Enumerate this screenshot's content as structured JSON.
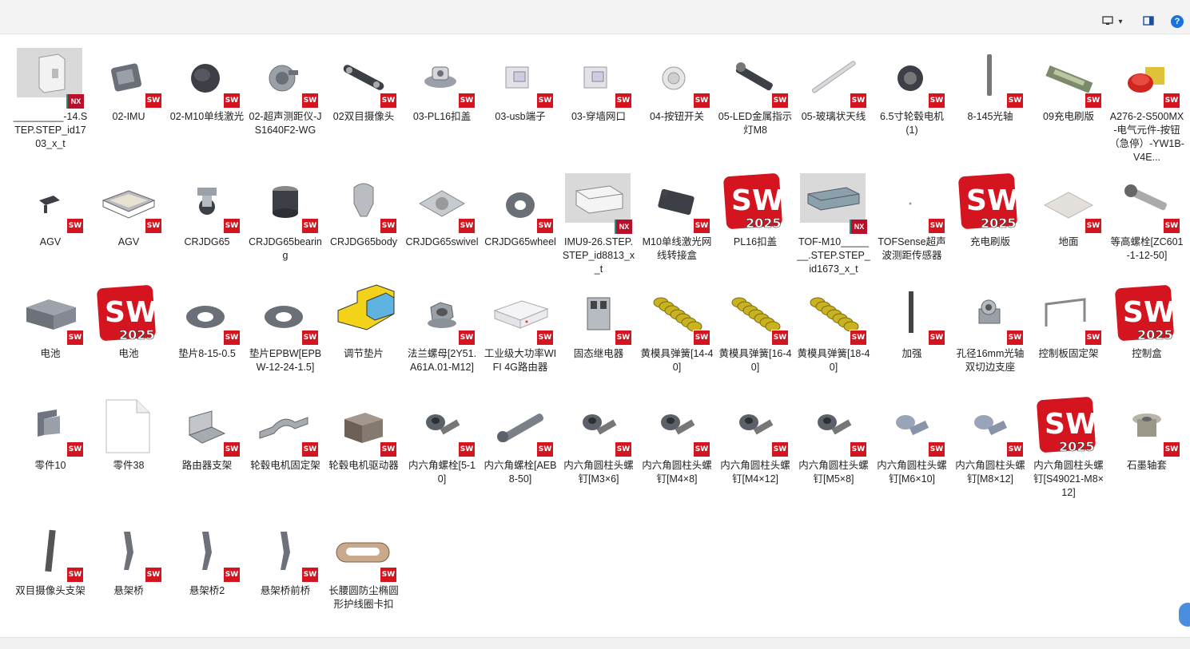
{
  "toolbar": {
    "view_icon": "monitor-view-icon",
    "view_caret": "▾",
    "pane_icon": "preview-pane-icon",
    "help_label": "?"
  },
  "colors": {
    "sw_red": "#d4151f",
    "nx_red": "#b8102a",
    "accent_blue": "#1a73d9",
    "toolbar_bg": "#f3f3f3"
  },
  "files": [
    {
      "name": "_________-14.STEP.STEP_id1703_x_t",
      "kind": "render",
      "badge": "NX"
    },
    {
      "name": "02-IMU",
      "kind": "imu",
      "badge": "SW"
    },
    {
      "name": "02-M10单线激光",
      "kind": "dome",
      "badge": "SW"
    },
    {
      "name": "02-超声测距仪-JS1640F2-WG",
      "kind": "sensor",
      "badge": "SW"
    },
    {
      "name": "02双目摄像头",
      "kind": "bar",
      "badge": "SW"
    },
    {
      "name": "03-PL16扣盖",
      "kind": "clip",
      "badge": "SW"
    },
    {
      "name": "03-usb端子",
      "kind": "usb",
      "badge": "SW"
    },
    {
      "name": "03-穿墙网口",
      "kind": "usb",
      "badge": "SW"
    },
    {
      "name": "04-按钮开关",
      "kind": "button",
      "badge": "SW"
    },
    {
      "name": "05-LED金属指示灯M8",
      "kind": "led",
      "badge": "SW"
    },
    {
      "name": "05-玻璃状天线",
      "kind": "antenna",
      "badge": "SW"
    },
    {
      "name": "6.5寸轮毂电机(1)",
      "kind": "wheel",
      "badge": "SW"
    },
    {
      "name": "8-145光轴",
      "kind": "rod",
      "badge": "SW"
    },
    {
      "name": "09充电刷版",
      "kind": "pcb",
      "badge": "SW"
    },
    {
      "name": "A276-2-S500MX-电气元件-按钮（急停）-YW1B-V4E...",
      "kind": "estop",
      "badge": "SW"
    },
    {
      "name": "AGV",
      "kind": "agvsmall",
      "badge": "SW"
    },
    {
      "name": "AGV",
      "kind": "tray",
      "badge": "SW"
    },
    {
      "name": "CRJDG65",
      "kind": "caster",
      "badge": "SW"
    },
    {
      "name": "CRJDG65bearing",
      "kind": "cyl",
      "badge": "SW"
    },
    {
      "name": "CRJDG65body",
      "kind": "body",
      "badge": "SW"
    },
    {
      "name": "CRJDG65swivel",
      "kind": "plate",
      "badge": "SW"
    },
    {
      "name": "CRJDG65wheel",
      "kind": "ring",
      "badge": "SW"
    },
    {
      "name": "IMU9-26.STEP.STEP_id8813_x_t",
      "kind": "render2",
      "badge": "NX"
    },
    {
      "name": "M10单线激光网线转接盒",
      "kind": "box",
      "badge": "SW"
    },
    {
      "name": "PL16扣盖",
      "kind": "swlogo",
      "badge": ""
    },
    {
      "name": "TOF-M10_______.STEP.STEP_id1673_x_t",
      "kind": "render3",
      "badge": "NX"
    },
    {
      "name": "TOFSense超声波测距传感器",
      "kind": "dot",
      "badge": "SW"
    },
    {
      "name": "充电刷版",
      "kind": "swlogo",
      "badge": ""
    },
    {
      "name": "地面",
      "kind": "floor",
      "badge": "SW"
    },
    {
      "name": "等高螺栓[ZC601-1-12-50]",
      "kind": "bolt",
      "badge": "SW"
    },
    {
      "name": "电池",
      "kind": "battery",
      "badge": "SW"
    },
    {
      "name": "电池",
      "kind": "swlogo",
      "badge": ""
    },
    {
      "name": "垫片8-15-0.5",
      "kind": "washer",
      "badge": "SW"
    },
    {
      "name": "垫片EPBW[EPBW-12-24-1.5]",
      "kind": "washer",
      "badge": "SW"
    },
    {
      "name": "调节垫片",
      "kind": "asm",
      "badge": ""
    },
    {
      "name": "法兰螺母[2Y51.A61A.01-M12]",
      "kind": "nut",
      "badge": "SW"
    },
    {
      "name": "工业级大功率WIFI 4G路由器",
      "kind": "router",
      "badge": "SW"
    },
    {
      "name": "固态继电器",
      "kind": "relay",
      "badge": "SW"
    },
    {
      "name": "黄模具弹簧[14-40]",
      "kind": "spring",
      "badge": "SW"
    },
    {
      "name": "黄模具弹簧[16-40]",
      "kind": "spring",
      "badge": "SW"
    },
    {
      "name": "黄模具弹簧[18-40]",
      "kind": "spring",
      "badge": "SW"
    },
    {
      "name": "加强",
      "kind": "thinbar",
      "badge": "SW"
    },
    {
      "name": "孔径16mm光轴双切边支座",
      "kind": "support",
      "badge": "SW"
    },
    {
      "name": "控制板固定架",
      "kind": "bracket",
      "badge": "SW"
    },
    {
      "name": "控制盒",
      "kind": "swlogo",
      "badge": ""
    },
    {
      "name": "零件10",
      "kind": "part10",
      "badge": "SW"
    },
    {
      "name": "零件38",
      "kind": "doc",
      "badge": ""
    },
    {
      "name": "路由器支架",
      "kind": "lbracket",
      "badge": "SW"
    },
    {
      "name": "轮毂电机固定架",
      "kind": "clamp",
      "badge": "SW"
    },
    {
      "name": "轮毂电机驱动器",
      "kind": "driver",
      "badge": "SW"
    },
    {
      "name": "内六角螺栓[5-10]",
      "kind": "screw",
      "badge": "SW"
    },
    {
      "name": "内六角螺栓[AEB8-50]",
      "kind": "pin",
      "badge": "SW"
    },
    {
      "name": "内六角圆柱头螺钉[M3×6]",
      "kind": "screw",
      "badge": "SW"
    },
    {
      "name": "内六角圆柱头螺钉[M4×8]",
      "kind": "screw",
      "badge": "SW"
    },
    {
      "name": "内六角圆柱头螺钉[M4×12]",
      "kind": "screw",
      "badge": "SW"
    },
    {
      "name": "内六角圆柱头螺钉[M5×8]",
      "kind": "screw",
      "badge": "SW"
    },
    {
      "name": "内六角圆柱头螺钉[M6×10]",
      "kind": "shoulder",
      "badge": "SW"
    },
    {
      "name": "内六角圆柱头螺钉[M8×12]",
      "kind": "shoulder",
      "badge": "SW"
    },
    {
      "name": "内六角圆柱头螺钉[S49021-M8×12]",
      "kind": "swlogo",
      "badge": ""
    },
    {
      "name": "石墨轴套",
      "kind": "bushing",
      "badge": "SW"
    },
    {
      "name": "双目摄像头支架",
      "kind": "stand",
      "badge": "SW"
    },
    {
      "name": "悬架桥",
      "kind": "susp",
      "badge": "SW"
    },
    {
      "name": "悬架桥2",
      "kind": "susp",
      "badge": "SW"
    },
    {
      "name": "悬架桥前桥",
      "kind": "susp",
      "badge": "SW"
    },
    {
      "name": "长腰圆防尘椭圆形护线圈卡扣",
      "kind": "grommet",
      "badge": "SW"
    }
  ]
}
